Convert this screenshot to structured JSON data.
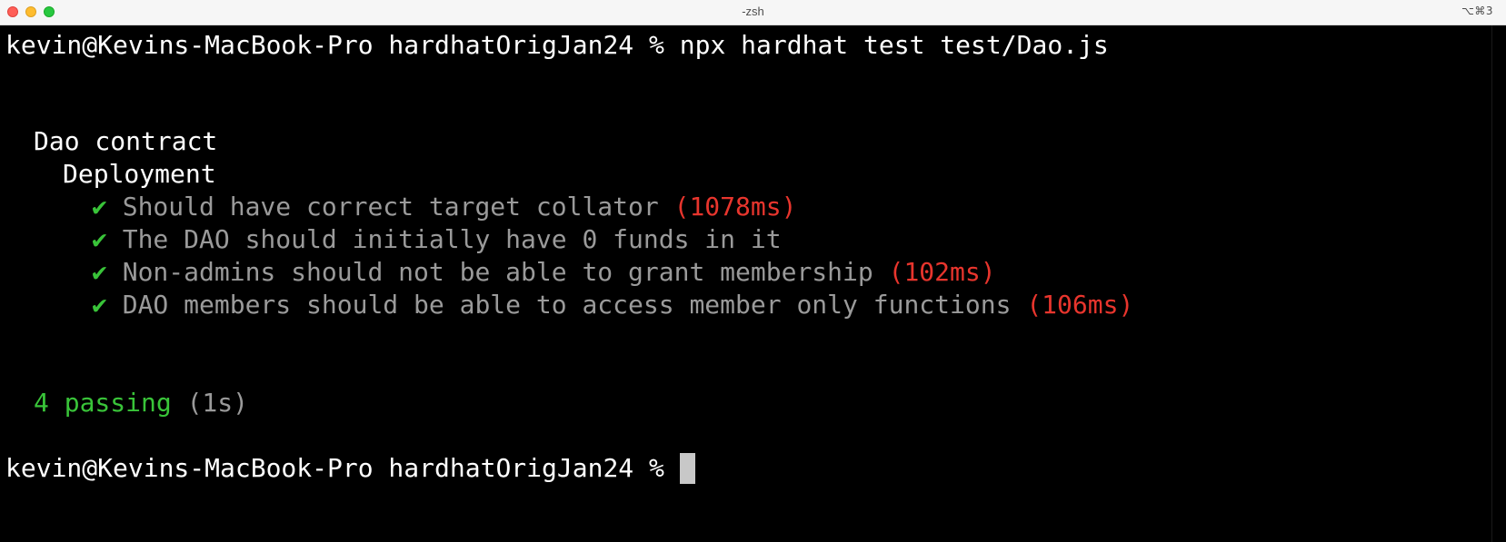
{
  "window": {
    "title": "-zsh",
    "shortcut": "⌥⌘3"
  },
  "terminal": {
    "command_line": {
      "prompt": "kevin@Kevins-MacBook-Pro hardhatOrigJan24 % ",
      "command": "npx hardhat test test/Dao.js"
    },
    "suite": {
      "name": "Dao contract",
      "group": "Deployment",
      "check_glyph": "✔",
      "tests": [
        {
          "title": "Should have correct target collator",
          "duration": "(1078ms)"
        },
        {
          "title": "The DAO should initially have 0 funds in it",
          "duration": ""
        },
        {
          "title": "Non-admins should not be able to grant membership",
          "duration": "(102ms)"
        },
        {
          "title": "DAO members should be able to access member only functions",
          "duration": "(106ms)"
        }
      ]
    },
    "summary": {
      "passing": "4 passing",
      "time": "(1s)"
    },
    "final_prompt": "kevin@Kevins-MacBook-Pro hardhatOrigJan24 % "
  }
}
